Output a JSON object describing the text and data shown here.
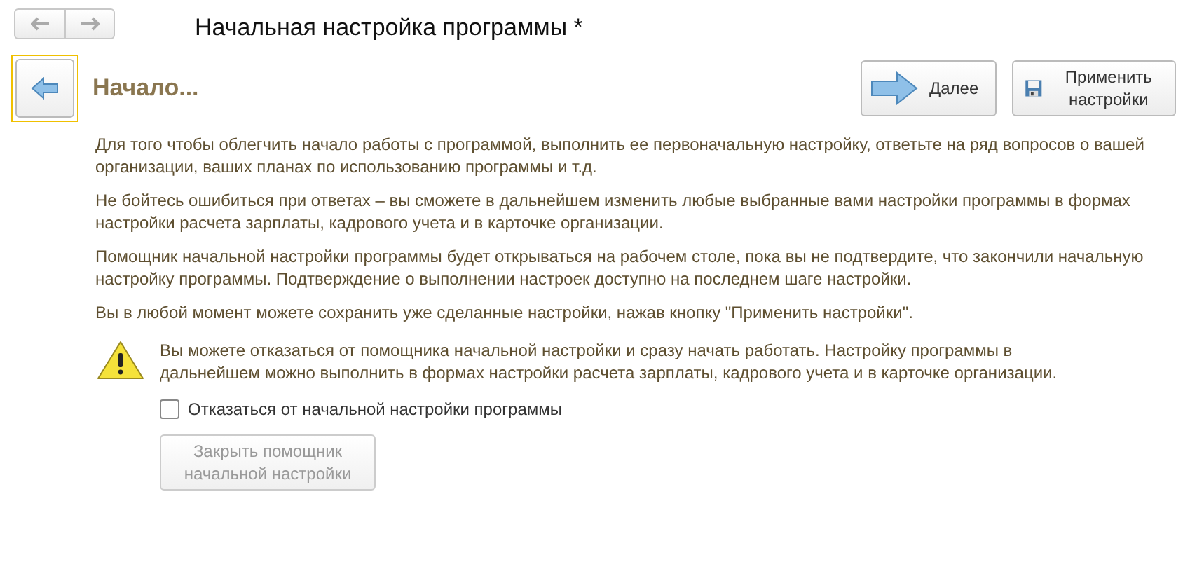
{
  "window": {
    "title": "Начальная настройка программы *"
  },
  "step": {
    "title": "Начало..."
  },
  "buttons": [
    {
      "kind": "next",
      "label": "Далее"
    },
    {
      "kind": "save",
      "label": "Применить настройки"
    }
  ],
  "paragraphs": [
    "Для того чтобы облегчить начало работы с программой, выполнить ее первоначальную настройку, ответьте на ряд вопросов о вашей организации, ваших планах по использованию программы и т.д.",
    "Не бойтесь ошибиться при ответах – вы сможете в дальнейшем изменить любые выбранные вами настройки программы в формах настройки расчета зарплаты, кадрового учета и в карточке организации.",
    "Помощник начальной настройки программы будет открываться на рабочем столе, пока вы не подтвердите, что закончили начальную настройку программы. Подтверждение о выполнении настроек доступно на последнем шаге настройки.",
    "Вы в любой момент можете сохранить уже сделанные настройки, нажав кнопку \"Применить настройки\"."
  ],
  "warning": {
    "text": "Вы можете отказаться от помощника начальной настройки и сразу начать работать. Настройку программы в дальнейшем можно выполнить в формах настройки расчета зарплаты, кадрового учета и в карточке организации."
  },
  "refuse_checkbox": {
    "label": "Отказаться от начальной настройки программы",
    "checked": false
  },
  "close_button": {
    "label": "Закрыть помощник начальной настройки",
    "disabled": true
  }
}
